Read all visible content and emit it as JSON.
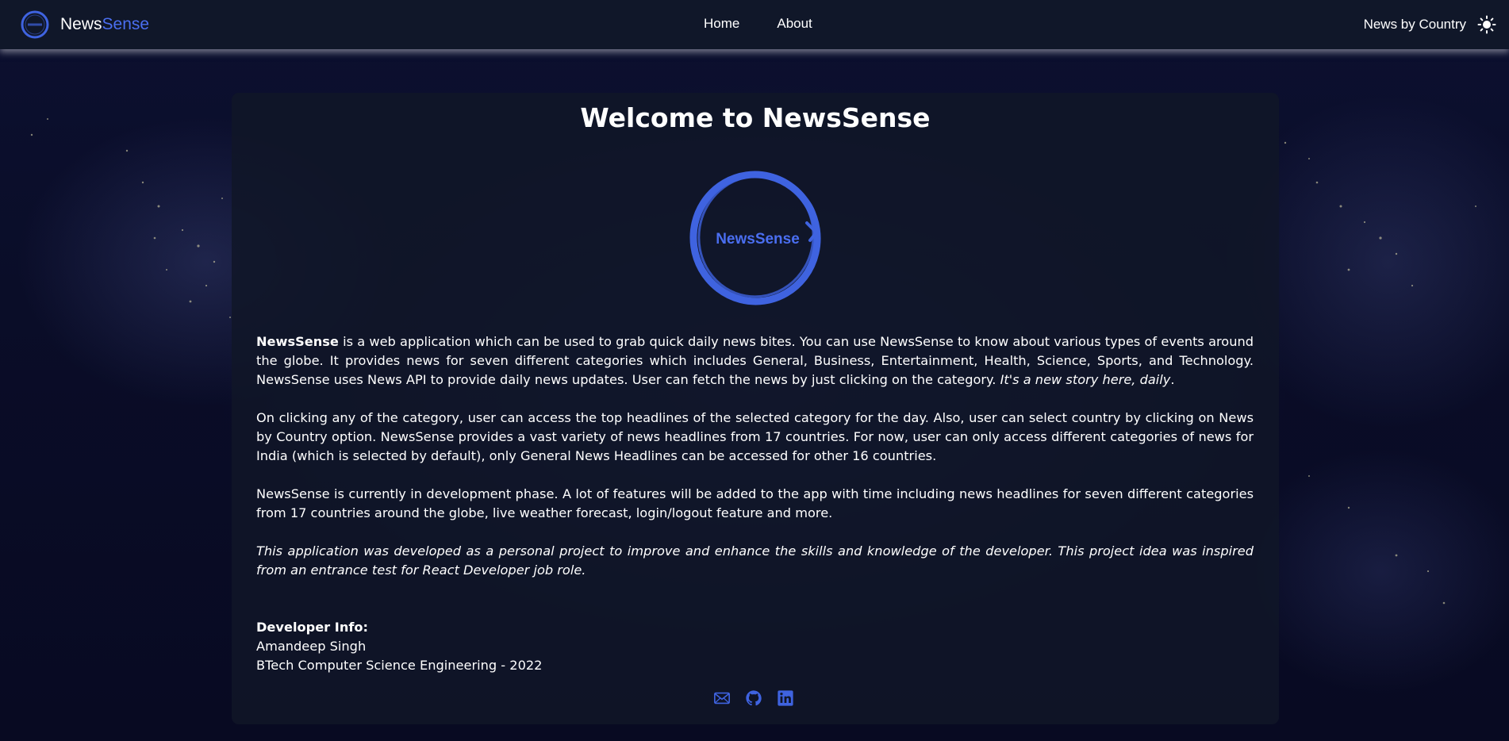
{
  "brand": {
    "name_part1": "News",
    "name_part2": "Sense",
    "accent_color": "#4a6ef0",
    "logo_icon": "newssense-logo-icon"
  },
  "nav": {
    "links": [
      "Home",
      "About"
    ],
    "country_label": "News by Country",
    "theme_icon": "sun-icon"
  },
  "main": {
    "title": "Welcome to NewsSense",
    "logo_text": "NewsSense",
    "p1_bold": "NewsSense",
    "p1_text": " is a web application which can be used to grab quick daily news bites. You can use NewsSense to know about various types of events around the globe. It provides news for seven different categories which includes General, Business, Entertainment, Health, Science, Sports, and Technology. NewsSense uses News API to provide daily news updates. User can fetch the news by just clicking on the category. ",
    "p1_italic": "It's a new story here, daily",
    "p1_end": ".",
    "p2": "On clicking any of the category, user can access the top headlines of the selected category for the day. Also, user can select country by clicking on News by Country option. NewsSense provides a vast variety of news headlines from 17 countries. For now, user can only access different categories of news for India (which is selected by default), only General News Headlines can be accessed for other 16 countries.",
    "p3": "NewsSense is currently in development phase. A lot of features will be added to the app with time including news headlines for seven different categories from 17 countries around the globe, live weather forecast, login/logout feature and more.",
    "p4": "This application was developed as a personal project to improve and enhance the skills and knowledge of the developer. This project idea was inspired from an entrance test for React Developer job role.",
    "developer": {
      "heading": "Developer Info:",
      "name": "Amandeep Singh",
      "degree": "BTech Computer Science Engineering - 2022"
    },
    "socials": [
      "mail-icon",
      "github-icon",
      "linkedin-icon"
    ]
  }
}
